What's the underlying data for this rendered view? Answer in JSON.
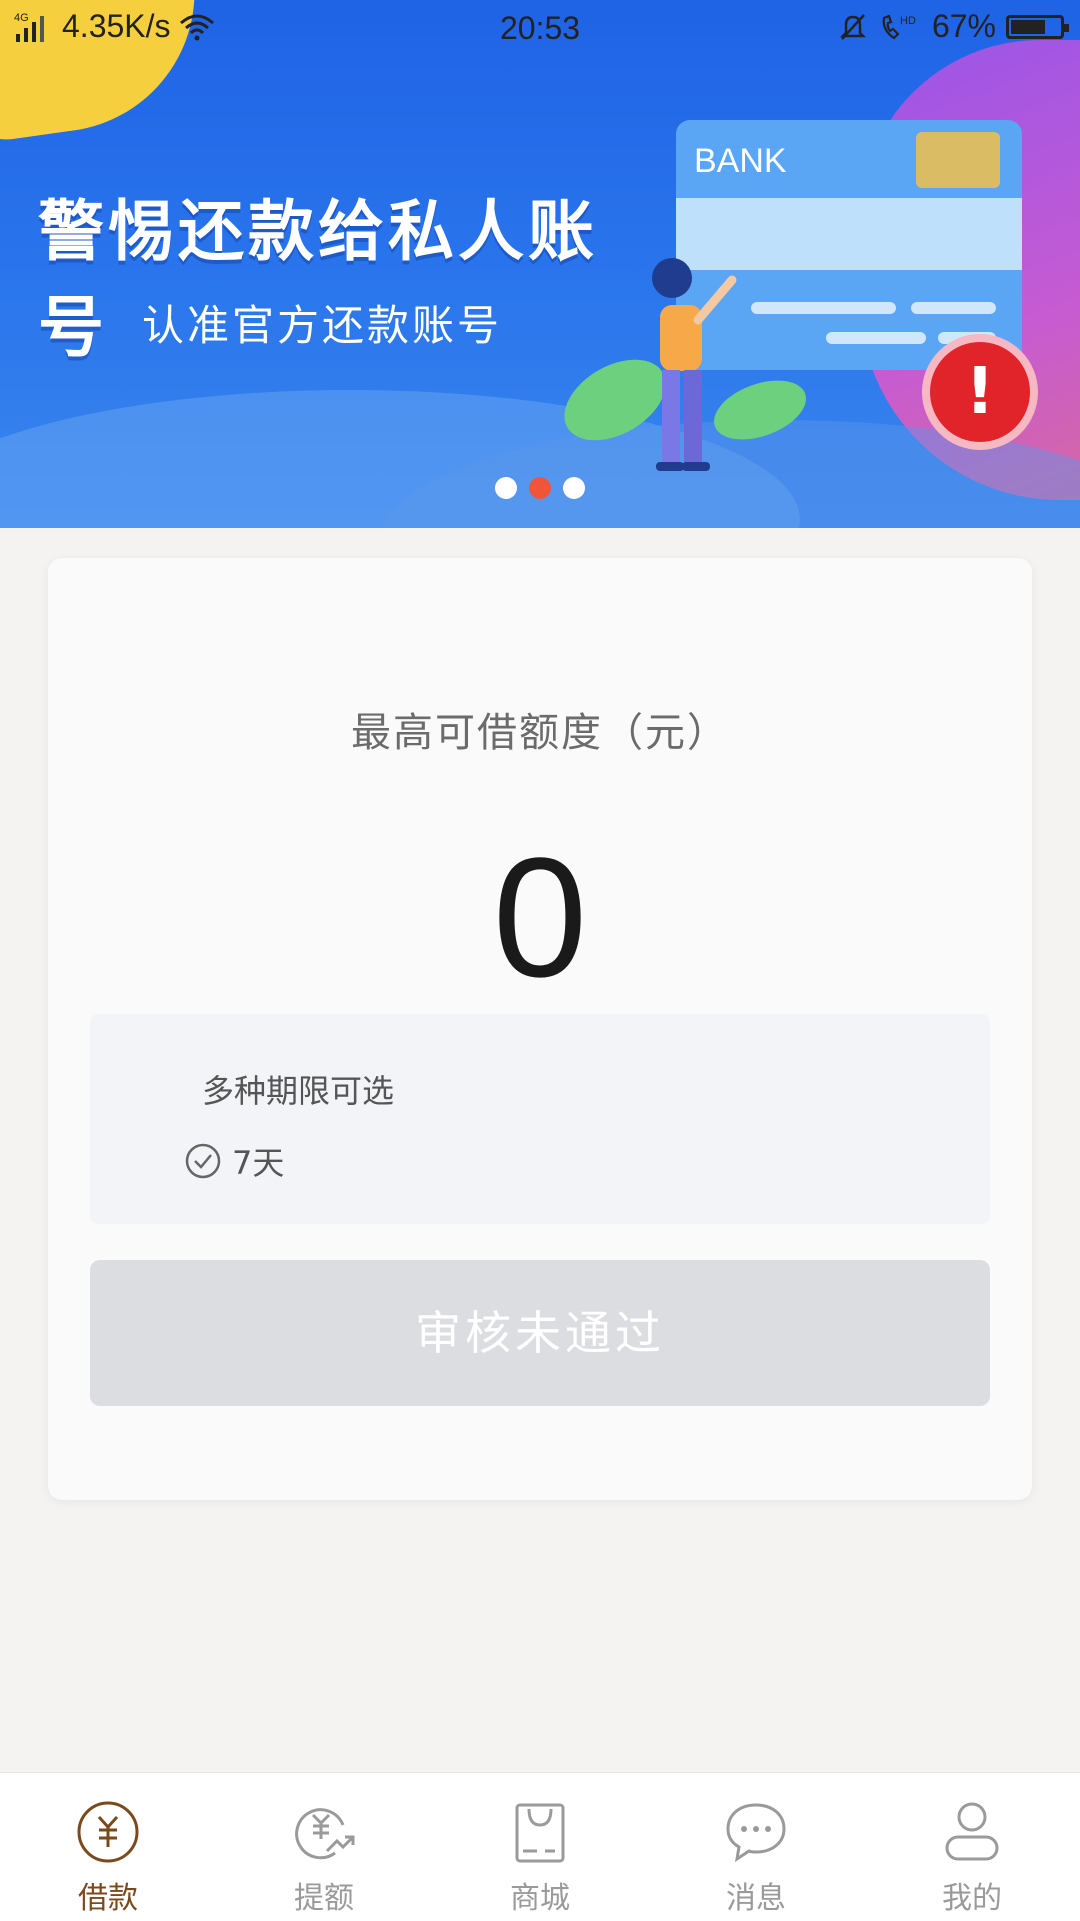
{
  "status_bar": {
    "network": "4G",
    "speed": "4.35K/s",
    "time": "20:53",
    "battery": "67%",
    "hd": "HD"
  },
  "banner": {
    "title": "警惕还款给私人账号",
    "subtitle": "认准官方还款账号",
    "card_text": "BANK",
    "alert_mark": "!",
    "carousel_active_index": 1,
    "carousel_count": 3,
    "colors": {
      "accent_dot": "#f0553a",
      "alert": "#e1232a"
    }
  },
  "loan_card": {
    "limit_label": "最高可借额度（元）",
    "limit_value": "0",
    "term_title": "多种期限可选",
    "term_option": "7天",
    "status_button": "审核未通过"
  },
  "tabbar": {
    "items": [
      {
        "label": "借款",
        "icon": "yuan-circle-icon",
        "active": true
      },
      {
        "label": "提额",
        "icon": "raise-limit-icon",
        "active": false
      },
      {
        "label": "商城",
        "icon": "shopping-bag-icon",
        "active": false
      },
      {
        "label": "消息",
        "icon": "chat-bubble-icon",
        "active": false
      },
      {
        "label": "我的",
        "icon": "user-icon",
        "active": false
      }
    ],
    "active_color": "#7a4a1c",
    "inactive_color": "#9a9a9a"
  }
}
